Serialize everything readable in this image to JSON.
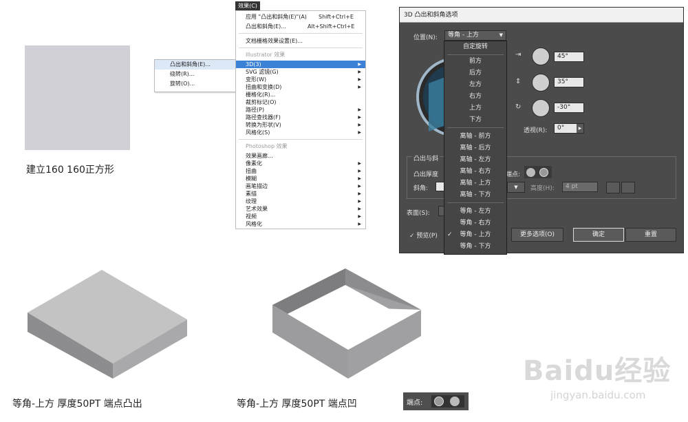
{
  "captions": {
    "square": "建立160 160正方形",
    "result1": "等角-上方   厚度50PT  端点凸出",
    "result2": "等角-上方   厚度50PT  端点凹"
  },
  "submenu": {
    "items": [
      "凸出和斜角(E)...",
      "绕转(R)...",
      "旋转(O)..."
    ]
  },
  "effect_menu": {
    "title": "效果(C)",
    "apply_last": {
      "label": "应用 \"凸出和斜角(E)\"(A)",
      "shortcut": "Shift+Ctrl+E"
    },
    "last": {
      "label": "凸出和斜角(E)...",
      "shortcut": "Alt+Shift+Ctrl+E"
    },
    "raster_settings": "文档栅格效果设置(E)...",
    "illustrator_header": "Illustrator 效果",
    "illustrator_items": [
      "3D(3)",
      "SVG 滤镜(G)",
      "变形(W)",
      "扭曲和变换(D)",
      "栅格化(R)...",
      "裁剪标记(O)",
      "路径(P)",
      "路径查找器(F)",
      "转换为形状(V)",
      "风格化(S)"
    ],
    "photoshop_header": "Photoshop 效果",
    "photoshop_items": [
      "效果画廊...",
      "像素化",
      "扭曲",
      "模糊",
      "画笔描边",
      "素描",
      "纹理",
      "艺术效果",
      "视频",
      "风格化"
    ]
  },
  "dialog": {
    "title": "3D 凸出和斜角选项",
    "position_label": "位置(N):",
    "position_value": "等角 - 上方",
    "angle_x": "45°",
    "angle_y": "35°",
    "angle_z": "-30°",
    "perspective_label": "透视(R):",
    "perspective_value": "0°",
    "extrude_section": "凸出与斜",
    "extrude_depth": "凸出厚度",
    "cap_label": "端点:",
    "bevel_label": "斜角:",
    "height_label": "高度(H):",
    "height_value": "4 pt",
    "surface_label": "表面(S):",
    "preview_label": "预览(P)",
    "more_options": "更多选项(O)",
    "ok": "确定",
    "reset": "重置",
    "dropdown_options": [
      "自定旋转",
      "前方",
      "后方",
      "左方",
      "右方",
      "上方",
      "下方",
      "离轴 - 前方",
      "离轴 - 后方",
      "离轴 - 左方",
      "离轴 - 右方",
      "离轴 - 上方",
      "离轴 - 下方",
      "等角 - 左方",
      "等角 - 右方",
      "等角 - 上方",
      "等角 - 下方"
    ]
  },
  "cap_badge": {
    "label": "端点:"
  },
  "watermark": {
    "logo": "Baidu经验",
    "url": "jingyan.baidu.com"
  },
  "colors": {
    "accent": "#3b82d6",
    "dialog_bg": "#4b4b4b",
    "square": "#d0d0d6"
  }
}
